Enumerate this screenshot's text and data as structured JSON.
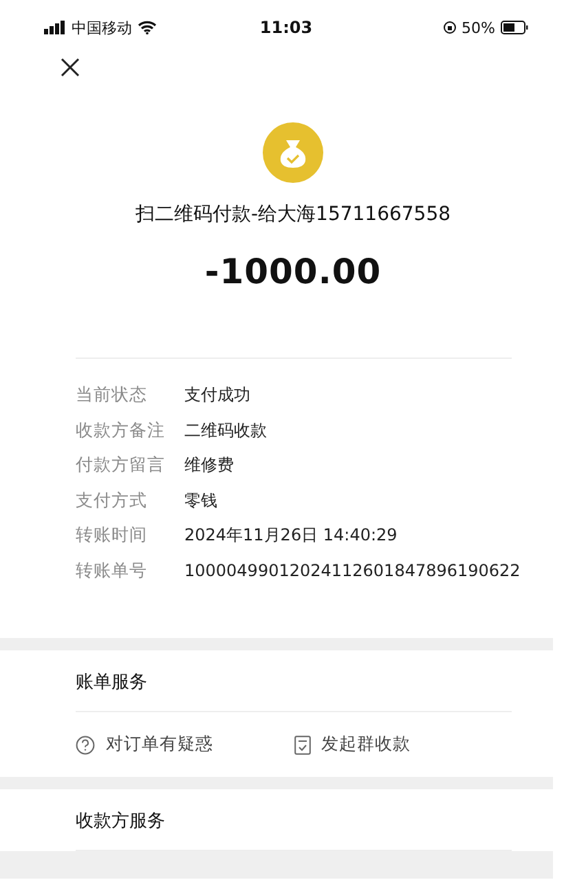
{
  "status_bar": {
    "carrier": "中国移动",
    "time": "11:03",
    "battery": "50%"
  },
  "payment": {
    "title": "扫二维码付款-给大海15711667558",
    "amount": "-1000.00"
  },
  "details": [
    {
      "label": "当前状态",
      "value": "支付成功"
    },
    {
      "label": "收款方备注",
      "value": "二维码收款"
    },
    {
      "label": "付款方留言",
      "value": "维修费"
    },
    {
      "label": "支付方式",
      "value": "零钱"
    },
    {
      "label": "转账时间",
      "value": "2024年11月26日 14:40:29"
    },
    {
      "label": "转账单号",
      "value": "10000499012024112601847896190622"
    }
  ],
  "bill_service": {
    "title": "账单服务",
    "actions": [
      {
        "kind": "question",
        "label": "对订单有疑惑"
      },
      {
        "kind": "document",
        "label": "发起群收款"
      }
    ]
  },
  "payee_service": {
    "title": "收款方服务"
  }
}
